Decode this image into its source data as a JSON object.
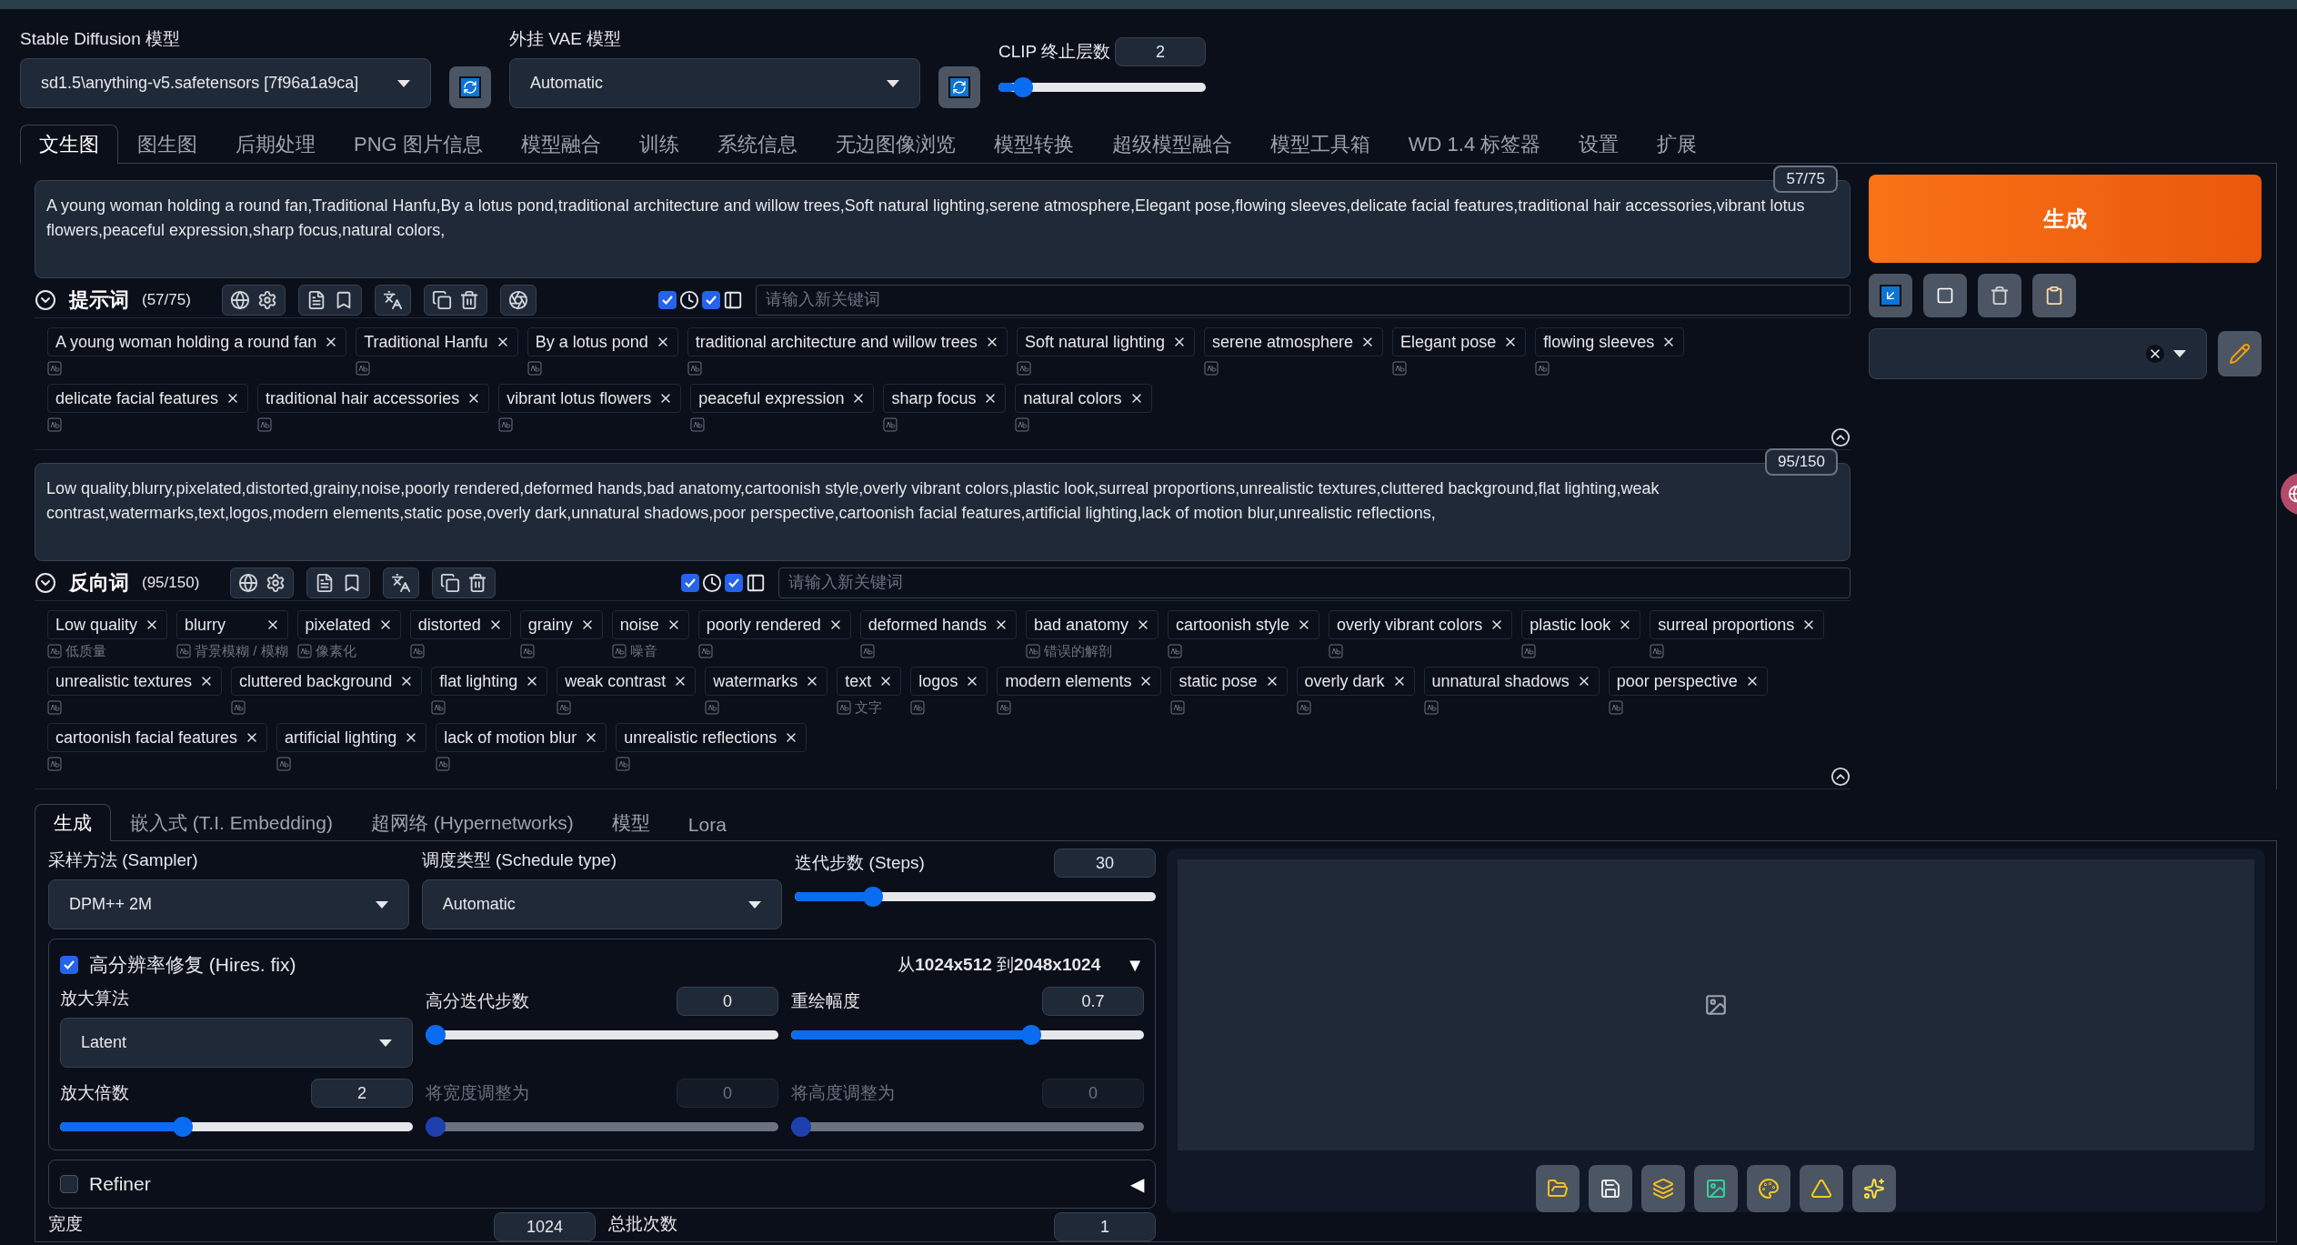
{
  "models": [
    {
      "label": "Stable Diffusion 模型",
      "value": "sd1.5\\anything-v5.safetensors [7f96a1a9ca]"
    },
    {
      "label": "外挂 VAE 模型",
      "value": "Automatic"
    }
  ],
  "clip": {
    "label": "CLIP 终止层数",
    "value": "2",
    "level": 0.08
  },
  "tabs": [
    {
      "label": "文生图",
      "selected": true
    },
    {
      "label": "图生图",
      "selected": false
    },
    {
      "label": "后期处理",
      "selected": false
    },
    {
      "label": "PNG 图片信息",
      "selected": false
    },
    {
      "label": "模型融合",
      "selected": false
    },
    {
      "label": "训练",
      "selected": false
    },
    {
      "label": "系统信息",
      "selected": false
    },
    {
      "label": "无边图像浏览",
      "selected": false
    },
    {
      "label": "模型转换",
      "selected": false
    },
    {
      "label": "超级模型融合",
      "selected": false
    },
    {
      "label": "模型工具箱",
      "selected": false
    },
    {
      "label": "WD 1.4 标签器",
      "selected": false
    },
    {
      "label": "设置",
      "selected": false
    },
    {
      "label": "扩展",
      "selected": false
    }
  ],
  "prompts": [
    {
      "text": "A young woman holding a round fan,Traditional Hanfu,By a lotus pond,traditional architecture and willow trees,Soft natural lighting,serene atmosphere,Elegant pose,flowing sleeves,delicate facial features,traditional hair accessories,vibrant lotus flowers,peaceful expression,sharp focus,natural colors,",
      "counter": "57/75",
      "title": "提示词",
      "count": "(57/75)",
      "ai_button": true,
      "toggles": [
        {
          "checked": true
        },
        {
          "checked": true
        }
      ],
      "placeholder": "请输入新关键词",
      "tags": [
        {
          "text": "A young woman holding a round fan"
        },
        {
          "text": "Traditional Hanfu"
        },
        {
          "text": "By a lotus pond"
        },
        {
          "text": "traditional architecture and willow trees"
        },
        {
          "text": "Soft natural lighting"
        },
        {
          "text": "serene atmosphere"
        },
        {
          "text": "Elegant pose"
        },
        {
          "text": "flowing sleeves"
        },
        {
          "text": "delicate facial features"
        },
        {
          "text": "traditional hair accessories"
        },
        {
          "text": "vibrant lotus flowers"
        },
        {
          "text": "peaceful expression"
        },
        {
          "text": "sharp focus"
        },
        {
          "text": "natural colors"
        }
      ]
    },
    {
      "text": "Low quality,blurry,pixelated,distorted,grainy,noise,poorly rendered,deformed hands,bad anatomy,cartoonish style,overly vibrant colors,plastic look,surreal proportions,unrealistic textures,cluttered background,flat lighting,weak contrast,watermarks,text,logos,modern elements,static pose,overly dark,unnatural shadows,poor perspective,cartoonish facial features,artificial lighting,lack of motion blur,unrealistic reflections,",
      "counter": "95/150",
      "title": "反向词",
      "count": "(95/150)",
      "ai_button": false,
      "toggles": [
        {
          "checked": true
        },
        {
          "checked": true
        }
      ],
      "placeholder": "请输入新关键词",
      "tags": [
        {
          "text": "Low quality",
          "translation": "低质量"
        },
        {
          "text": "blurry",
          "translation": "背景模糊 / 模糊"
        },
        {
          "text": "pixelated",
          "translation": "像素化"
        },
        {
          "text": "distorted"
        },
        {
          "text": "grainy"
        },
        {
          "text": "noise",
          "translation": "噪音"
        },
        {
          "text": "poorly rendered"
        },
        {
          "text": "deformed hands"
        },
        {
          "text": "bad anatomy",
          "translation": "错误的解剖"
        },
        {
          "text": "cartoonish style"
        },
        {
          "text": "overly vibrant colors"
        },
        {
          "text": "plastic look"
        },
        {
          "text": "surreal proportions"
        },
        {
          "text": "unrealistic textures"
        },
        {
          "text": "cluttered background"
        },
        {
          "text": "flat lighting"
        },
        {
          "text": "weak contrast"
        },
        {
          "text": "watermarks"
        },
        {
          "text": "text",
          "translation": "文字"
        },
        {
          "text": "logos"
        },
        {
          "text": "modern elements"
        },
        {
          "text": "static pose"
        },
        {
          "text": "overly dark"
        },
        {
          "text": "unnatural shadows"
        },
        {
          "text": "poor perspective"
        },
        {
          "text": "cartoonish facial features"
        },
        {
          "text": "artificial lighting"
        },
        {
          "text": "lack of motion blur"
        },
        {
          "text": "unrealistic reflections"
        }
      ]
    }
  ],
  "generate": {
    "label": "生成"
  },
  "sub_tabs": [
    {
      "label": "生成",
      "selected": true
    },
    {
      "label": "嵌入式 (T.I. Embedding)",
      "selected": false
    },
    {
      "label": "超网络 (Hypernetworks)",
      "selected": false
    },
    {
      "label": "模型",
      "selected": false
    },
    {
      "label": "Lora",
      "selected": false
    }
  ],
  "sampler": {
    "label": "采样方法 (Sampler)",
    "value": "DPM++ 2M"
  },
  "schedule": {
    "label": "调度类型 (Schedule type)",
    "value": "Automatic"
  },
  "steps": {
    "label": "迭代步数 (Steps)",
    "value": "30",
    "level": 0.2
  },
  "hires": {
    "label": "高分辨率修复 (Hires. fix)",
    "checked": true,
    "summary": "从**1024x512** 到**2048x1024**",
    "arrow": "▼",
    "upscaler": {
      "label": "放大算法",
      "value": "Latent"
    },
    "sliders": [
      {
        "label": "高分迭代步数",
        "value": "0",
        "level": 0,
        "disabled": false
      },
      {
        "label": "重绘幅度",
        "value": "0.7",
        "level": 0.69,
        "disabled": false
      },
      {
        "label": "放大倍数",
        "value": "2",
        "level": 0.34,
        "disabled": false
      },
      {
        "label": "将宽度调整为",
        "value": "0",
        "level": 0,
        "disabled": true
      },
      {
        "label": "将高度调整为",
        "value": "0",
        "level": 0,
        "disabled": true
      }
    ]
  },
  "refiner": {
    "label": "Refiner",
    "checked": false,
    "arrow": "◀"
  },
  "bottom_fields": [
    {
      "label": "宽度",
      "value": "1024"
    },
    {
      "label": "总批次数",
      "value": "1"
    }
  ]
}
